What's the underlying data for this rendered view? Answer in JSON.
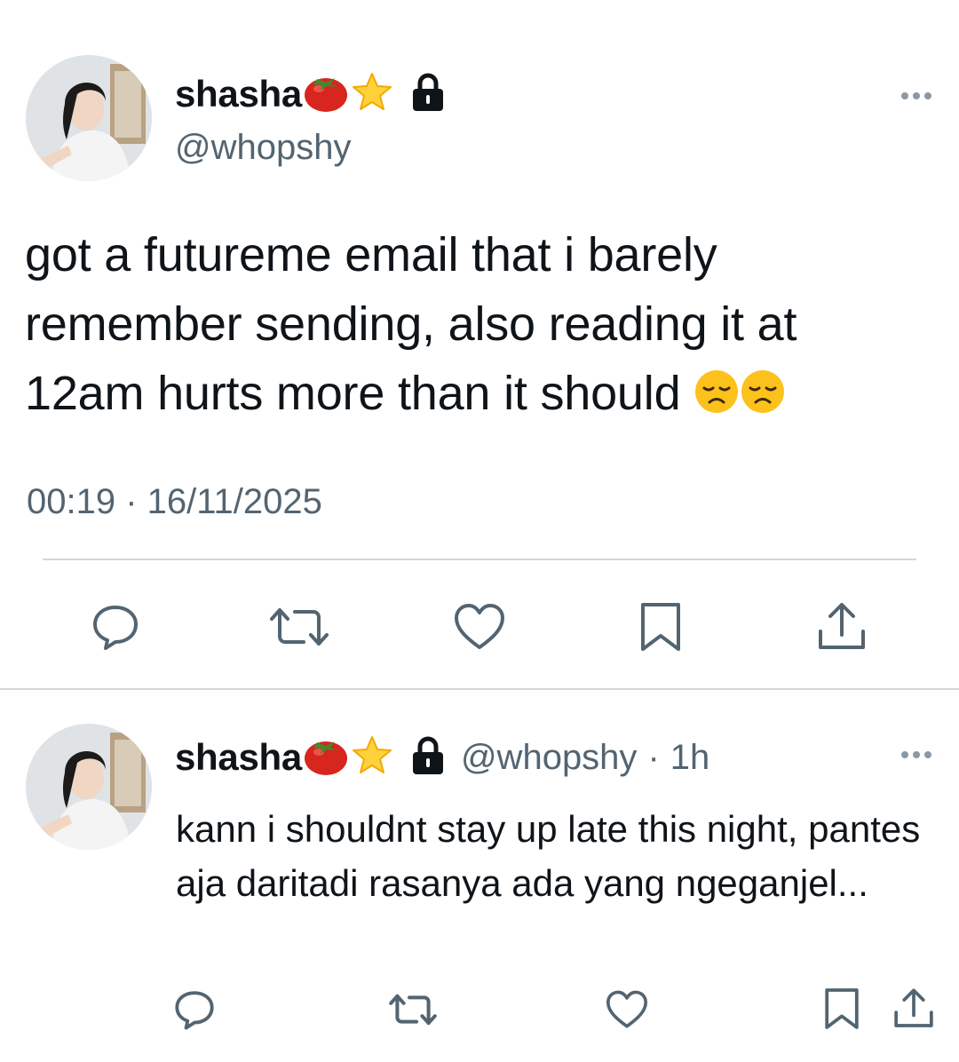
{
  "main_tweet": {
    "display_name": "shasha",
    "handle": "@whopshy",
    "text": "got a futureme email that i barely remember sending, also reading it at 12am hurts more than it should",
    "timestamp": "00:19 · 16/11/2025"
  },
  "reply_tweet": {
    "display_name": "shasha",
    "handle": "@whopshy",
    "separator": "·",
    "time_ago": "1h",
    "text": "kann i shouldnt stay up late this night, pantes aja daritadi rasanya ada yang ngeganjel..."
  },
  "icons": [
    "tomato-emoji",
    "star-emoji",
    "lock-icon",
    "more-icon",
    "sad-face-emoji",
    "reply-icon",
    "retweet-icon",
    "like-icon",
    "bookmark-icon",
    "share-icon"
  ],
  "colors": {
    "text": "#0f1419",
    "secondary": "#536471",
    "divider": "#cfd9de",
    "icon": "#536471"
  }
}
